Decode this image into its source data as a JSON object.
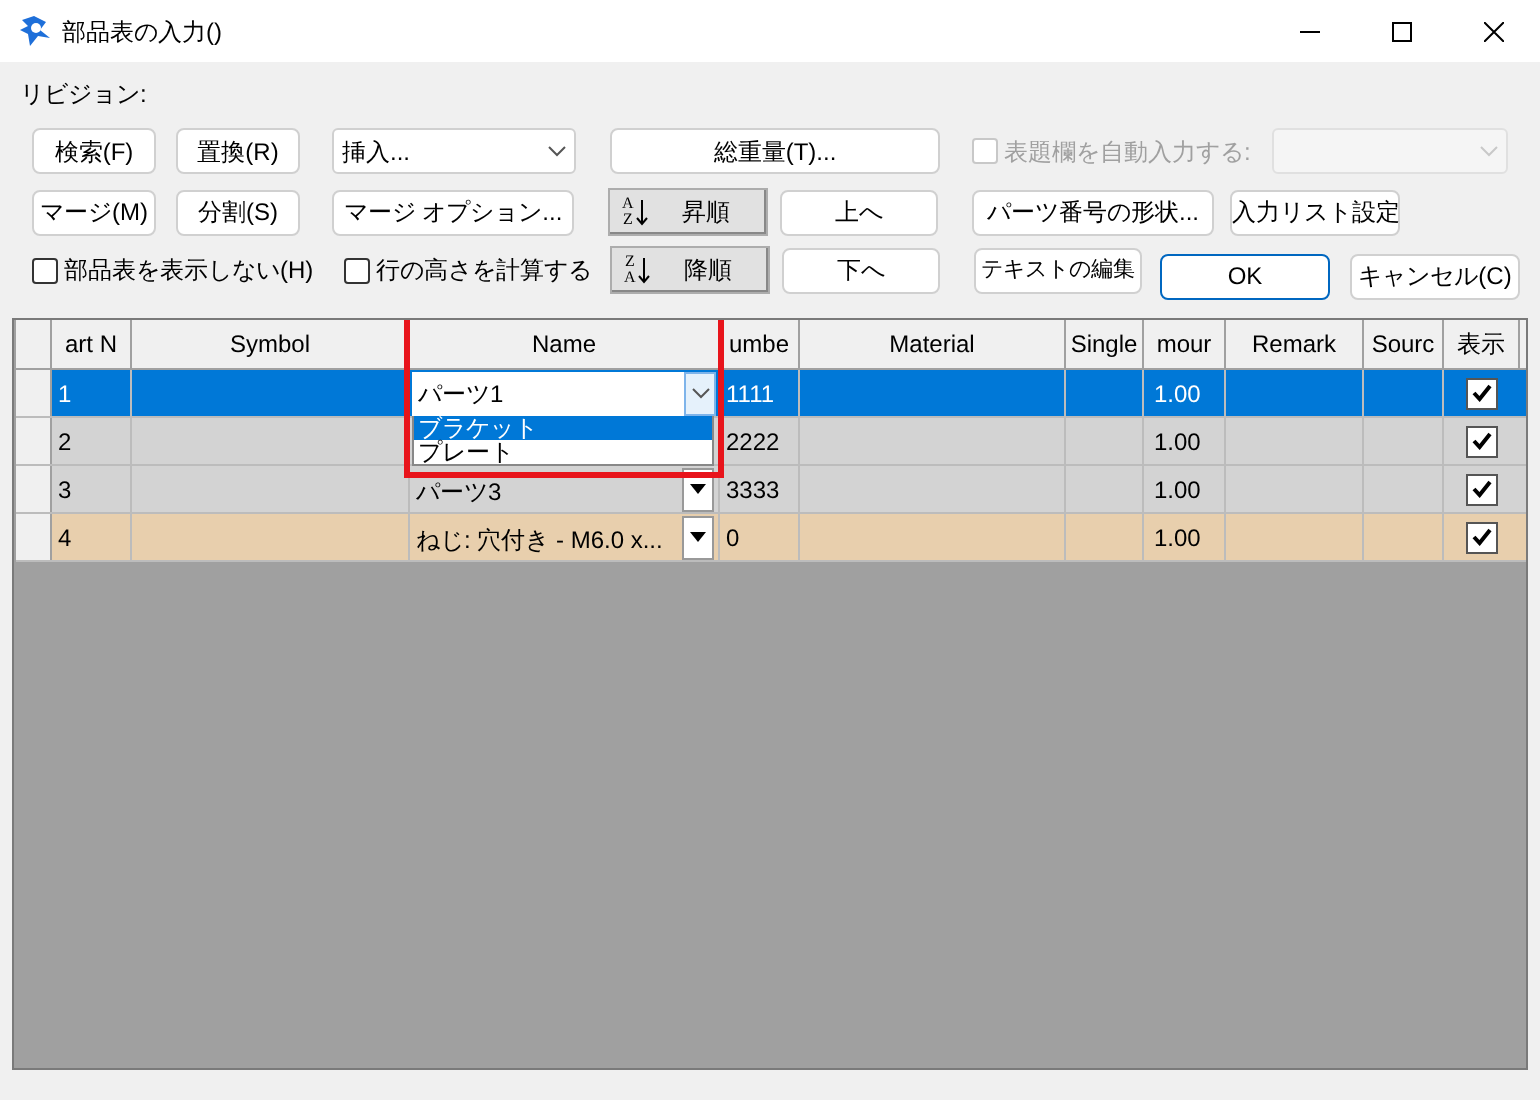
{
  "window": {
    "title": "部品表の入力()"
  },
  "revision_label": "リビジョン:",
  "toolbar": [
    [
      {
        "kind": "button",
        "label": "検索(F)"
      },
      {
        "kind": "button",
        "label": "置換(R)"
      },
      {
        "kind": "combo",
        "value": "挿入...",
        "disabled": false
      },
      {
        "kind": "button",
        "label": "総重量(T)..."
      },
      {
        "kind": "checkbox",
        "label": "表題欄を自動入力する:",
        "checked": false,
        "disabled": true
      },
      {
        "kind": "combo",
        "disabled": true
      }
    ],
    [
      {
        "kind": "button",
        "label": "マージ(M)"
      },
      {
        "kind": "button",
        "label": "分割(S)"
      },
      {
        "kind": "button",
        "label": "マージ オプション..."
      },
      {
        "kind": "sort",
        "icon_top": "A",
        "icon_bottom": "Z",
        "label": "昇順"
      },
      {
        "kind": "button",
        "label": "上へ"
      },
      {
        "kind": "button",
        "label": "パーツ番号の形状..."
      },
      {
        "kind": "button",
        "label": "入力リスト設定"
      }
    ],
    [
      {
        "kind": "checkbox",
        "label": "部品表を表示しない(H)",
        "checked": false,
        "disabled": false
      },
      {
        "kind": "checkbox",
        "label": "行の高さを計算する",
        "checked": false,
        "disabled": false
      },
      {
        "kind": "sort",
        "icon_top": "Z",
        "icon_bottom": "A",
        "label": "降順"
      },
      {
        "kind": "button",
        "label": "下へ"
      },
      {
        "kind": "button",
        "label": "テキストの編集"
      },
      {
        "kind": "default",
        "label": "OK"
      },
      {
        "kind": "button",
        "label": "キャンセル(C)"
      }
    ]
  ],
  "table": {
    "columns": [
      {
        "label": "art N",
        "highlighted": false
      },
      {
        "label": "Symbol",
        "highlighted": false
      },
      {
        "label": "Name",
        "highlighted": true
      },
      {
        "label": "umbe",
        "highlighted": false
      },
      {
        "label": "Material",
        "highlighted": false
      },
      {
        "label": "Single",
        "highlighted": false
      },
      {
        "label": "mour",
        "highlighted": false
      },
      {
        "label": "Remark",
        "highlighted": false
      },
      {
        "label": "Sourc",
        "highlighted": false
      },
      {
        "label": "表示",
        "highlighted": false
      }
    ],
    "rows": [
      {
        "selected": true,
        "color": "#0078d7",
        "part_no": "1",
        "name": {
          "value": "パーツ1",
          "editing": true,
          "options": [
            {
              "label": "ブラケット",
              "selected": true
            },
            {
              "label": "プレート",
              "selected": false
            }
          ]
        },
        "number": "1111",
        "amount": "1.00",
        "visible": true
      },
      {
        "selected": false,
        "color": "#d3d3d3",
        "part_no": "2",
        "number": "2222",
        "amount": "1.00",
        "visible": true
      },
      {
        "selected": false,
        "color": "#d3d3d3",
        "part_no": "3",
        "name": {
          "value": "パーツ3",
          "editing": false
        },
        "number": "3333",
        "amount": "1.00",
        "visible": true
      },
      {
        "selected": false,
        "color": "#e8cfad",
        "part_no": "4",
        "name": {
          "value": "ねじ: 穴付き - M6.0 x...",
          "editing": false
        },
        "number": "0",
        "amount": "1.00",
        "visible": true
      }
    ]
  }
}
